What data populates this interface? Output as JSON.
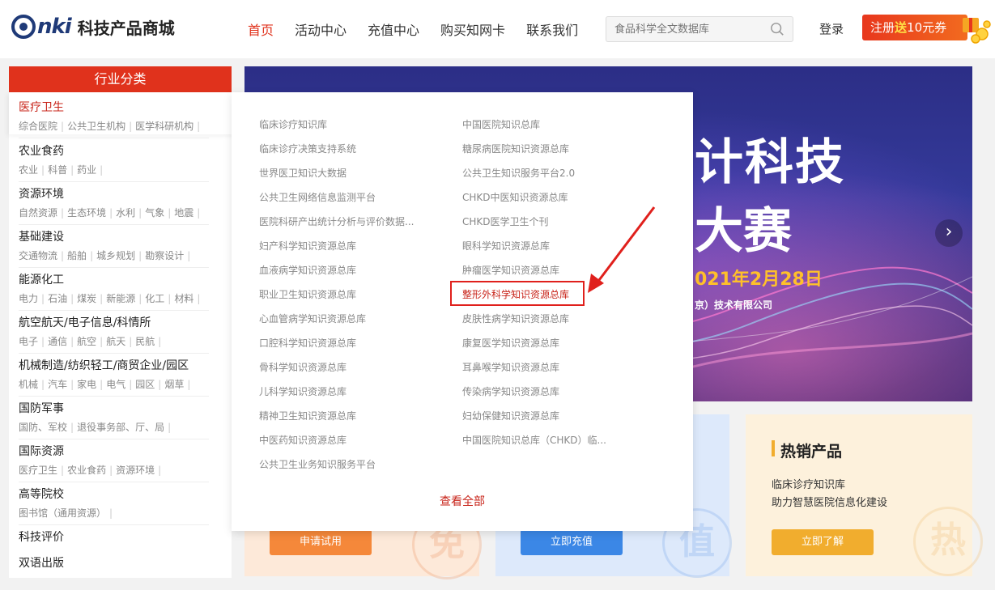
{
  "header": {
    "logo_text": "nki",
    "site_title": "科技产品商城",
    "nav": [
      "首页",
      "活动中心",
      "充值中心",
      "购买知网卡",
      "联系我们"
    ],
    "search_placeholder": "食品科学全文数据库",
    "login": "登录",
    "register_prefix": "注册",
    "register_em": "送",
    "register_suffix": "10元券"
  },
  "sidebar": {
    "heading": "行业分类",
    "categories": [
      {
        "title": "医疗卫生",
        "subs": [
          "综合医院",
          "公共卫生机构",
          "医学科研机构"
        ]
      },
      {
        "title": "农业食药",
        "subs": [
          "农业",
          "科普",
          "药业"
        ]
      },
      {
        "title": "资源环境",
        "subs": [
          "自然资源",
          "生态环境",
          "水利",
          "气象",
          "地震"
        ]
      },
      {
        "title": "基础建设",
        "subs": [
          "交通物流",
          "船舶",
          "城乡规划",
          "勘察设计"
        ]
      },
      {
        "title": "能源化工",
        "subs": [
          "电力",
          "石油",
          "煤炭",
          "新能源",
          "化工",
          "材料"
        ]
      },
      {
        "title": "航空航天/电子信息/科情所",
        "subs": [
          "电子",
          "通信",
          "航空",
          "航天",
          "民航"
        ]
      },
      {
        "title": "机械制造/纺织轻工/商贸企业/园区",
        "subs": [
          "机械",
          "汽车",
          "家电",
          "电气",
          "园区",
          "烟草"
        ]
      },
      {
        "title": "国防军事",
        "subs": [
          "国防、军校",
          "退役事务部、厅、局"
        ]
      },
      {
        "title": "国际资源",
        "subs": [
          "医疗卫生",
          "农业食药",
          "资源环境"
        ]
      },
      {
        "title": "高等院校",
        "subs": [
          "图书馆（通用资源）"
        ]
      },
      {
        "title": "科技评价",
        "subs": []
      },
      {
        "title": "双语出版",
        "subs": []
      }
    ]
  },
  "panel": {
    "left_column": [
      "临床诊疗知识库",
      "临床诊疗决策支持系统",
      "世界医卫知识大数据",
      "公共卫生网络信息监测平台",
      "医院科研产出统计分析与评价数据...",
      "妇产科学知识资源总库",
      "血液病学知识资源总库",
      "职业卫生知识资源总库",
      "心血管病学知识资源总库",
      "口腔科学知识资源总库",
      "骨科学知识资源总库",
      "儿科学知识资源总库",
      "精神卫生知识资源总库",
      "中医药知识资源总库",
      "公共卫生业务知识服务平台"
    ],
    "right_column": [
      "中国医院知识总库",
      "糖尿病医院知识资源总库",
      "公共卫生知识服务平台2.0",
      "CHKD中医知识资源总库",
      "CHKD医学卫生个刊",
      "眼科学知识资源总库",
      "肿瘤医学知识资源总库",
      "整形外科学知识资源总库",
      "皮肤性病学知识资源总库",
      "康复医学知识资源总库",
      "耳鼻喉学知识资源总库",
      "传染病学知识资源总库",
      "妇幼保健知识资源总库",
      "中国医院知识总库（CHKD）临..."
    ],
    "see_all": "查看全部"
  },
  "banner": {
    "line1": "计科技",
    "line2": "大赛",
    "date": "021年2月28日",
    "company": "京）技术有限公司",
    "next": "›"
  },
  "cards": {
    "trial_button": "申请试用",
    "trial_watermark": "免",
    "recharge_button": "立即充值",
    "recharge_text": "/",
    "recharge_watermark": "值",
    "hot_title": "热销产品",
    "hot_line1": "临床诊疗知识库",
    "hot_line2": "助力智慧医院信息化建设",
    "hot_button": "立即了解",
    "hot_watermark": "热"
  },
  "colors": {
    "brand_red": "#e0321c",
    "nav_blue": "#1f3a78",
    "link_red": "#c8241a"
  }
}
